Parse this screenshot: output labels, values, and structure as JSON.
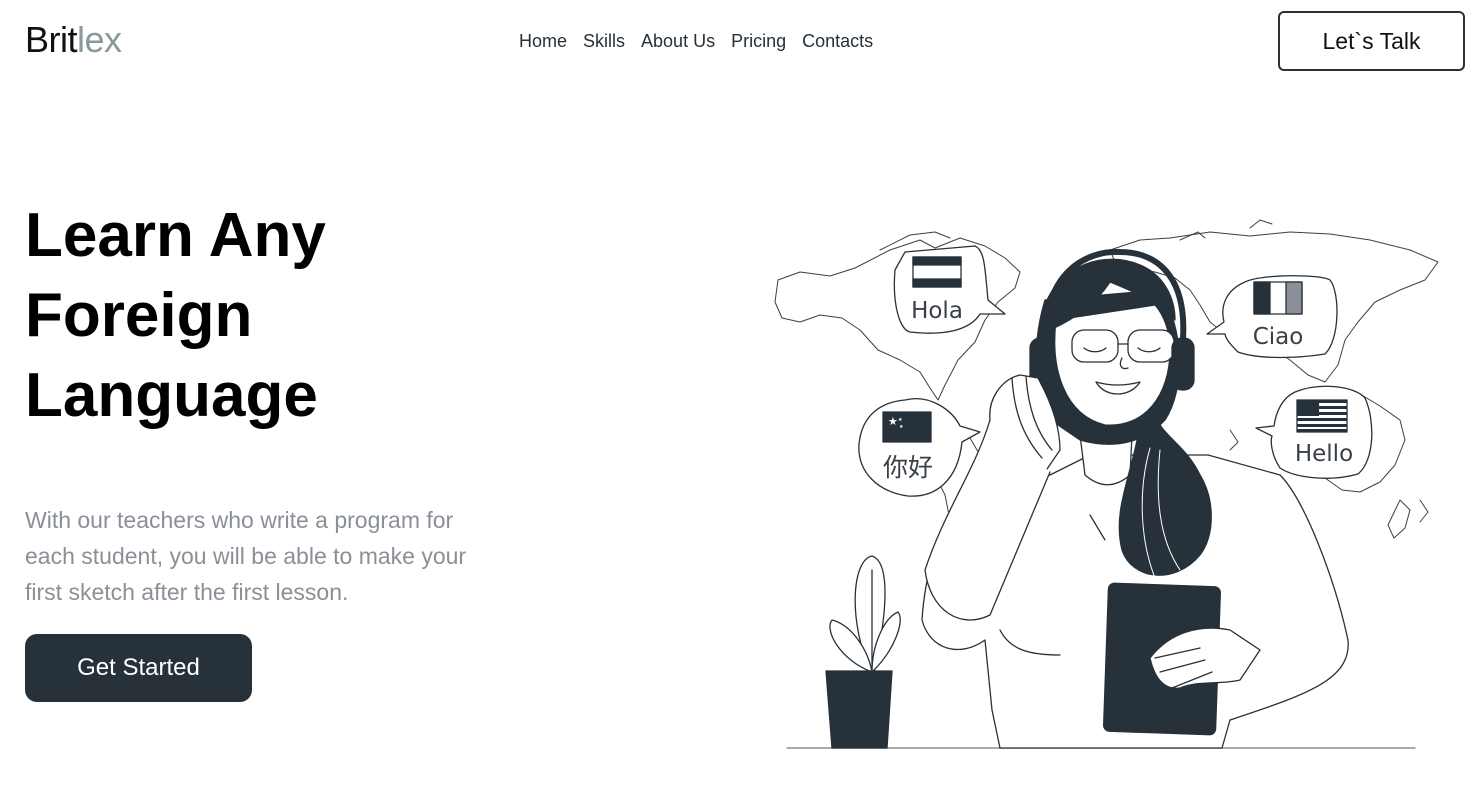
{
  "header": {
    "logo_part1": "Brit",
    "logo_part2": "lex",
    "nav": [
      "Home",
      "Skills",
      "About Us",
      "Pricing",
      "Contacts"
    ],
    "cta_label": "Let`s Talk"
  },
  "hero": {
    "title_lines": [
      "Learn Any",
      "Foreign",
      "Language"
    ],
    "subtitle": "With our teachers who write a program for each student, you will be able to make your first sketch after the first lesson.",
    "button_label": "Get Started"
  },
  "illustration": {
    "bubbles": [
      "Hola",
      "Ciao",
      "你好",
      "Hello"
    ],
    "flags": [
      "spain-flag-icon",
      "italy-flag-icon",
      "china-flag-icon",
      "usa-flag-icon"
    ]
  },
  "colors": {
    "dark": "#27313a",
    "logo_accent": "#8a9a9a",
    "muted_text": "#8a8f98"
  }
}
